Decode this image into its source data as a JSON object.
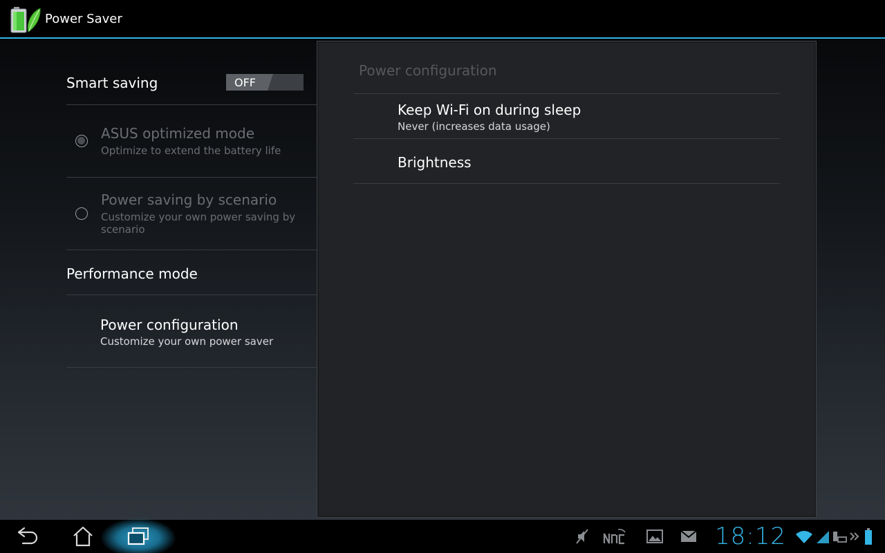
{
  "action_bar": {
    "title": "Power Saver",
    "app_icon": "battery-leaf-icon"
  },
  "left_pane": {
    "smart_saving": {
      "label": "Smart saving",
      "toggle_state": "OFF"
    },
    "options": [
      {
        "title": "ASUS optimized mode",
        "subtitle": "Optimize to extend the battery life",
        "selected": false,
        "enabled": false
      },
      {
        "title": "Power saving by scenario",
        "subtitle": "Customize your own power saving by scenario",
        "selected": false,
        "enabled": false
      }
    ],
    "performance_mode": {
      "label": "Performance mode"
    },
    "power_configuration": {
      "title": "Power configuration",
      "subtitle": "Customize your own power saver"
    }
  },
  "right_pane": {
    "title": "Power configuration",
    "items": [
      {
        "title": "Keep Wi-Fi on during sleep",
        "subtitle": "Never (increases data usage)"
      },
      {
        "title": "Brightness",
        "subtitle": ""
      }
    ]
  },
  "system_bar": {
    "nav": [
      "back-icon",
      "home-icon",
      "recent-apps-icon"
    ],
    "status_icons": [
      "muted-icon",
      "nfc-icon",
      "gallery-icon",
      "email-icon",
      "wifi-icon",
      "signal-icon",
      "usb-dock-icon",
      "more-icon",
      "battery-icon"
    ],
    "clock": "18:12"
  },
  "colors": {
    "accent": "#33b5e5",
    "disabled_text": "#6a6d72",
    "divider": "#3a3d41",
    "pane_bg": "#222326"
  }
}
